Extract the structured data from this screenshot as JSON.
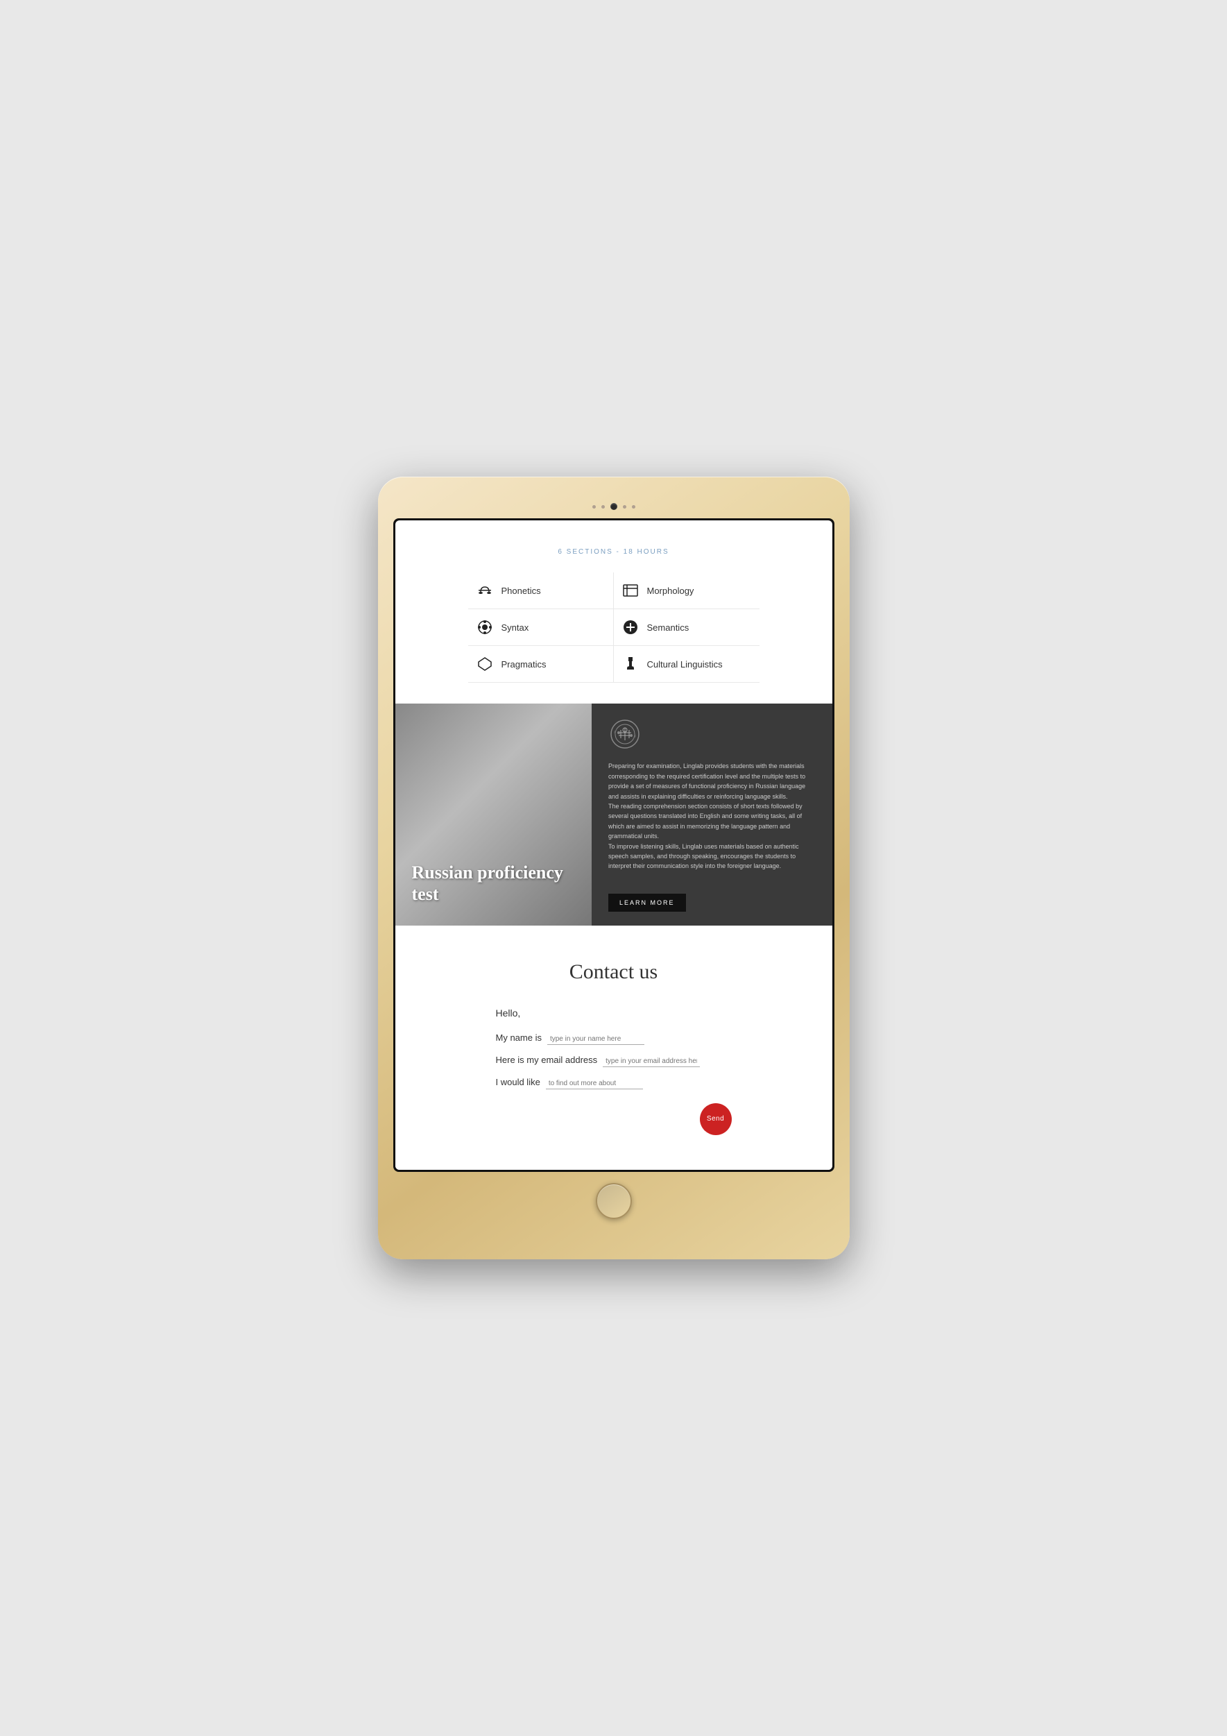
{
  "device": {
    "camera_alt": "camera"
  },
  "sections": {
    "subtitle": "6 SECTIONS - 18 HOURS",
    "items": [
      {
        "id": "phonetics",
        "label": "Phonetics",
        "icon": "graduation"
      },
      {
        "id": "morphology",
        "label": "Morphology",
        "icon": "book"
      },
      {
        "id": "syntax",
        "label": "Syntax",
        "icon": "dots"
      },
      {
        "id": "semantics",
        "label": "Semantics",
        "icon": "plus-circle"
      },
      {
        "id": "pragmatics",
        "label": "Pragmatics",
        "icon": "diamond"
      },
      {
        "id": "cultural",
        "label": "Cultural Linguistics",
        "icon": "chess"
      }
    ]
  },
  "hero": {
    "title": "Russian proficiency test",
    "description": "Preparing for examination, Linglab provides students with the materials corresponding to the required certification level and the multiple tests to provide a set of measures of functional proficiency in Russian language and assists in explaining difficulties or reinforcing language skills.\nThe reading comprehension section consists of short texts followed by several questions translated into English and some writing tasks, all of which are aimed to assist in memorizing the language pattern and grammatical units.\nTo improve listening skills, Linglab uses materials based on authentic speech samples, and through speaking, encourages the students to interpret their communication style into the foreigner language.",
    "learn_more_label": "LEARN MORE"
  },
  "contact": {
    "title": "Contact us",
    "hello_text": "Hello,",
    "name_label": "My name is",
    "name_placeholder": "type in your name here",
    "email_label": "Here is my email address",
    "email_placeholder": "type in your email address here",
    "like_label": "I would like",
    "like_placeholder": "to find out more about",
    "send_label": "Send"
  }
}
